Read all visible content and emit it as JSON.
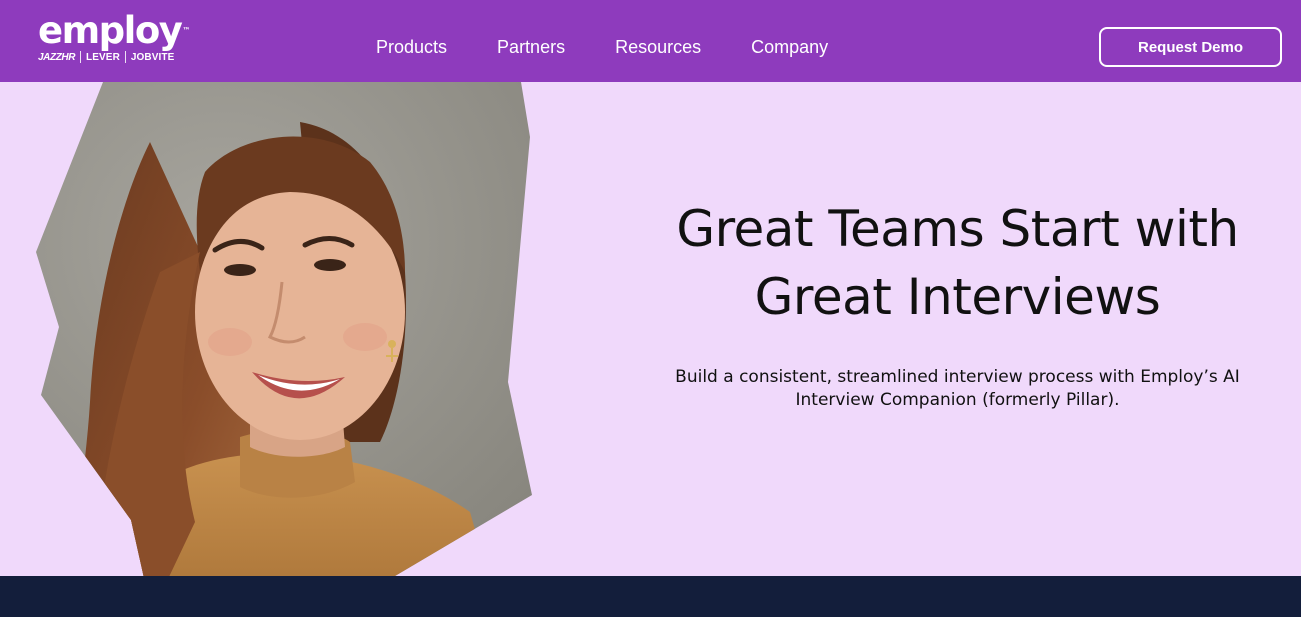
{
  "header": {
    "logo": {
      "wordmark": "employ",
      "trademark": "™",
      "brands": [
        "JAZZHR",
        "LEVER",
        "JOBVITE"
      ]
    },
    "nav": [
      "Products",
      "Partners",
      "Resources",
      "Company"
    ],
    "cta_label": "Request Demo"
  },
  "hero": {
    "headline_line1": "Great Teams Start with",
    "headline_line2": "Great Interviews",
    "subhead_line1": "Build a consistent, streamlined interview process with Employ’s AI",
    "subhead_line2": "Interview Companion (formerly Pillar)."
  },
  "colors": {
    "header_bg": "#8e3bbd",
    "hero_bg": "#f0d9fb",
    "footer_band": "#131e3b",
    "text": "#111111"
  }
}
